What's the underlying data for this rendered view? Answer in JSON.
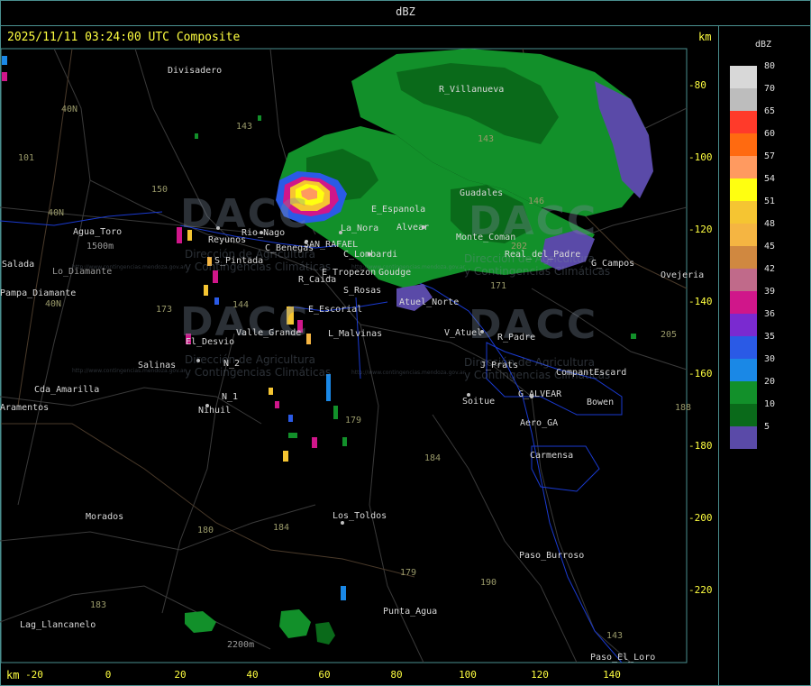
{
  "header": {
    "title": "dBZ"
  },
  "map": {
    "timestamp": "2025/11/11 03:24:00 UTC Composite",
    "km_label_top": "km",
    "km_label_bottom": "km",
    "y_ticks": [
      "-80",
      "-100",
      "-120",
      "-140",
      "-160",
      "-180",
      "-200",
      "-220"
    ],
    "x_ticks": [
      "-20",
      "0",
      "20",
      "40",
      "60",
      "80",
      "100",
      "120",
      "140"
    ],
    "places": [
      "Divisadero",
      "R_Villanueva",
      "Guadales",
      "La_Nora",
      "E_Espanola",
      "Agua_Toro",
      "Reyunos",
      "Rio_Nago",
      "C_Benegas",
      "SAN_RAFAEL",
      "C_Lombardi",
      "Alvear",
      "Monte_Coman",
      "S_Pintada",
      "R_Caida",
      "E_Tropezon",
      "Goudge",
      "S_Rosas",
      "Atuel_Norte",
      "Real_del_Padre",
      "G_Campos",
      "Ovejeria",
      "Pampa_Diamante",
      "Cda_Amarilla",
      "El_Desvio",
      "Valle_Grande",
      "E_Escorial",
      "L_Malvinas",
      "V_Atuel",
      "R_Padre",
      "J_Prats",
      "CompantEscard",
      "G_ALVEAR",
      "Bowen",
      "Soitue",
      "Aero_GA",
      "Carmensa",
      "Salinas",
      "N_2",
      "N_1",
      "Nihuil",
      "Morados",
      "Los_Toldos",
      "Paso_Burroso",
      "Punta_Agua",
      "Lag_Llancanelo",
      "Paso_El_Loro",
      "Salada",
      "Aramentos",
      "1500m",
      "2200m",
      "Lo_Diamante"
    ],
    "routes": [
      "143",
      "40N",
      "101",
      "40N",
      "150",
      "40N",
      "144",
      "173",
      "179",
      "184",
      "180",
      "184",
      "183",
      "179",
      "190",
      "171",
      "143",
      "146",
      "202",
      "205",
      "188",
      "143"
    ],
    "watermark": {
      "brand": "DACC",
      "line1": "Dirección de Agricultura",
      "line2": "y Contingencias Climáticas",
      "url": "http://www.contingencias.mendoza.gov.ar"
    }
  },
  "legend": {
    "title": "dBZ",
    "entries": [
      {
        "label": "80",
        "color": "#d8d8d8"
      },
      {
        "label": "70",
        "color": "#bdbdbd"
      },
      {
        "label": "65",
        "color": "#ff3a2a"
      },
      {
        "label": "60",
        "color": "#ff6a10"
      },
      {
        "label": "57",
        "color": "#ff9a60"
      },
      {
        "label": "54",
        "color": "#ffff10"
      },
      {
        "label": "51",
        "color": "#f5c532"
      },
      {
        "label": "48",
        "color": "#f5b542"
      },
      {
        "label": "45",
        "color": "#d08840"
      },
      {
        "label": "42",
        "color": "#c06a8a"
      },
      {
        "label": "39",
        "color": "#d0168a"
      },
      {
        "label": "36",
        "color": "#7a2ad0"
      },
      {
        "label": "35",
        "color": "#2a5ae6"
      },
      {
        "label": "30",
        "color": "#1a88e6"
      },
      {
        "label": "20",
        "color": "#12902a"
      },
      {
        "label": "10",
        "color": "#0a6a1a"
      },
      {
        "label": "5",
        "color": "#5a4aa8"
      }
    ]
  }
}
